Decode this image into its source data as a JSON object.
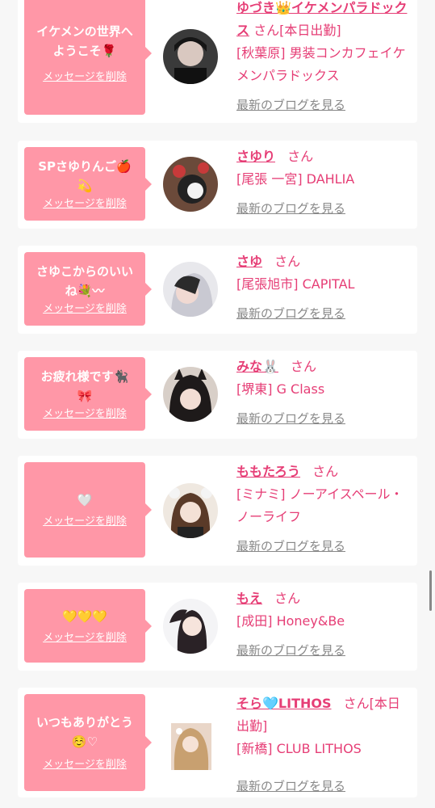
{
  "delete_label": "メッセージを削除",
  "blog_label": "最新のブログを見る",
  "san_label": "さん",
  "items": [
    {
      "message": "イケメンの世界へ\nようこそ🌹",
      "name": "ゆづき👑イケメンパラドックス",
      "status": "[本日出勤]",
      "shop": "[秋葉原] 男装コンカフェイケメンパラドックス"
    },
    {
      "message": "SPさゆりんご🍎\n💫",
      "name": "さゆり",
      "status": "",
      "shop": "[尾張 一宮] DAHLIA"
    },
    {
      "message": "さゆこからのいい\nね💐〰",
      "name": "さゆ",
      "status": "",
      "shop": "[尾張旭市] CAPITAL"
    },
    {
      "message": "お疲れ様です🐈‍⬛\n🎀",
      "name": "みな🐰",
      "status": "",
      "shop": "[堺東] G Class"
    },
    {
      "message": "🤍",
      "name": "ももたろう",
      "status": "",
      "shop": "[ミナミ] ノーアイスペール・ノーライフ"
    },
    {
      "message": "💛💛💛",
      "name": "もえ",
      "status": "",
      "shop": "[成田] Honey&Be"
    },
    {
      "message": "いつもありがとう\n☺️♡",
      "name": "そら🩵LITHOS",
      "status": "[本日出勤]",
      "shop": "[新橋] CLUB LITHOS"
    }
  ],
  "colors": {
    "bubble": "#ff97a7",
    "accent": "#e63e76",
    "link_gray": "#888888",
    "background": "#f7f7f7"
  }
}
